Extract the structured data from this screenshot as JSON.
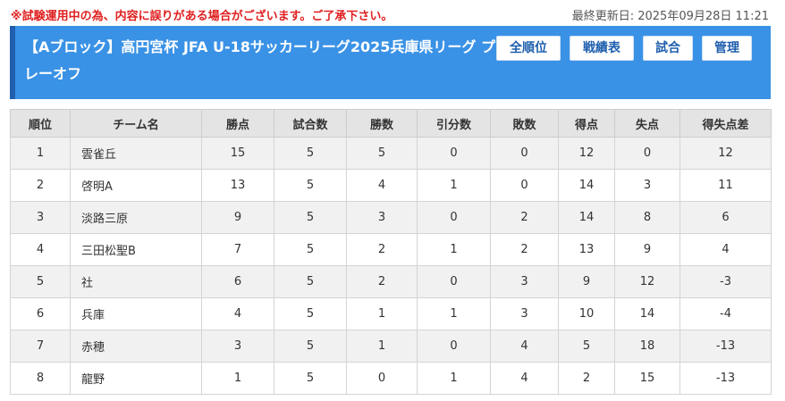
{
  "notice": "※試験運用中の為、内容に誤りがある場合がございます。ご了承下さい。",
  "last_updated": "最終更新日: 2025年09月28日 11:21",
  "header": {
    "title": "【Aブロック】高円宮杯 JFA U-18サッカーリーグ2025兵庫県リーグ プレーオフ",
    "nav": [
      "全順位",
      "戦績表",
      "試合",
      "管理"
    ]
  },
  "table": {
    "headers": [
      "順位",
      "チーム名",
      "勝点",
      "試合数",
      "勝数",
      "引分数",
      "敗数",
      "得点",
      "失点",
      "得失点差"
    ],
    "rows": [
      [
        "1",
        "雲雀丘",
        "15",
        "5",
        "5",
        "0",
        "0",
        "12",
        "0",
        "12"
      ],
      [
        "2",
        "啓明A",
        "13",
        "5",
        "4",
        "1",
        "0",
        "14",
        "3",
        "11"
      ],
      [
        "3",
        "淡路三原",
        "9",
        "5",
        "3",
        "0",
        "2",
        "14",
        "8",
        "6"
      ],
      [
        "4",
        "三田松聖B",
        "7",
        "5",
        "2",
        "1",
        "2",
        "13",
        "9",
        "4"
      ],
      [
        "5",
        "社",
        "6",
        "5",
        "2",
        "0",
        "3",
        "9",
        "12",
        "-3"
      ],
      [
        "6",
        "兵庫",
        "4",
        "5",
        "1",
        "1",
        "3",
        "10",
        "14",
        "-4"
      ],
      [
        "7",
        "赤穂",
        "3",
        "5",
        "1",
        "0",
        "4",
        "5",
        "18",
        "-13"
      ],
      [
        "8",
        "龍野",
        "1",
        "5",
        "0",
        "1",
        "4",
        "2",
        "15",
        "-13"
      ]
    ]
  }
}
